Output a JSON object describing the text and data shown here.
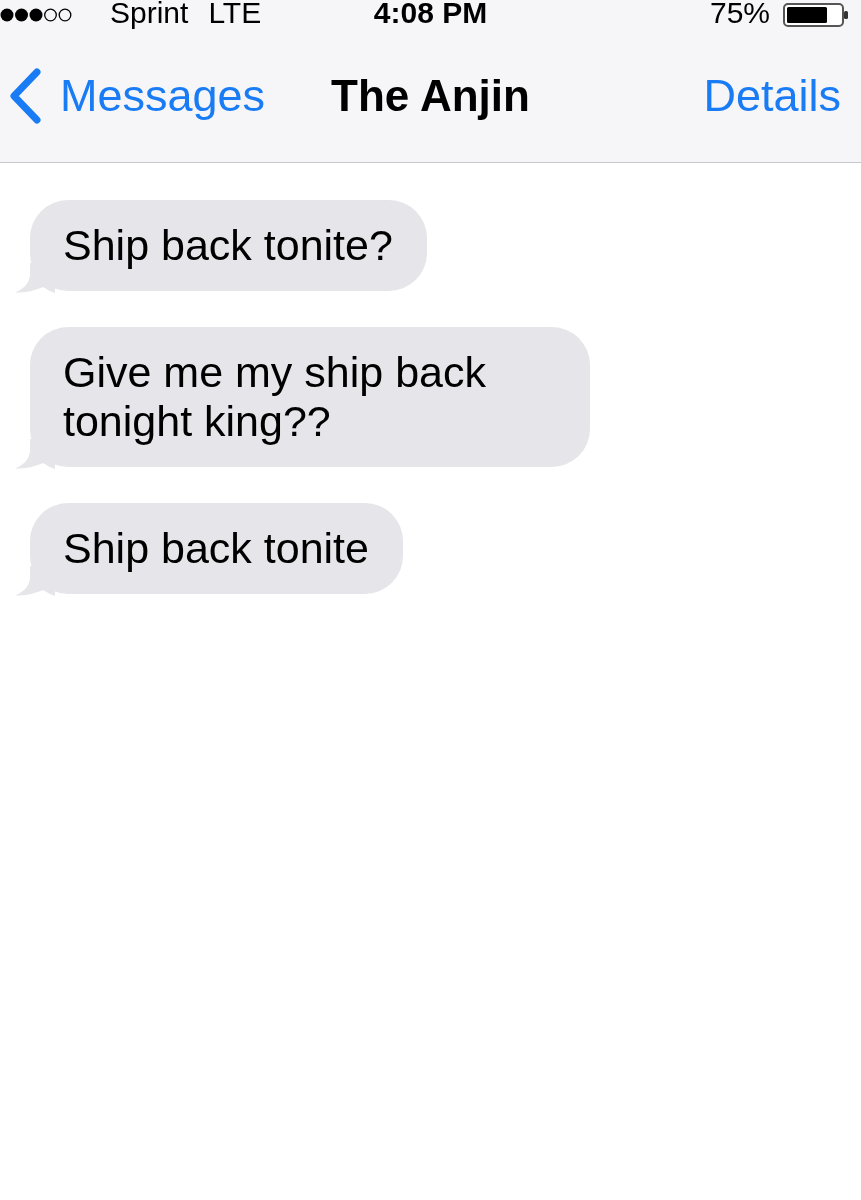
{
  "status_bar": {
    "carrier": "Sprint",
    "network": "LTE",
    "time": "4:08 PM",
    "battery": "75%"
  },
  "nav_bar": {
    "back": "Messages",
    "title": "The Anjin",
    "action": "Details"
  },
  "messages": [
    {
      "text": "Ship back tonite?"
    },
    {
      "text": "Give me my ship back tonight king??"
    },
    {
      "text": "Ship back tonite"
    }
  ]
}
